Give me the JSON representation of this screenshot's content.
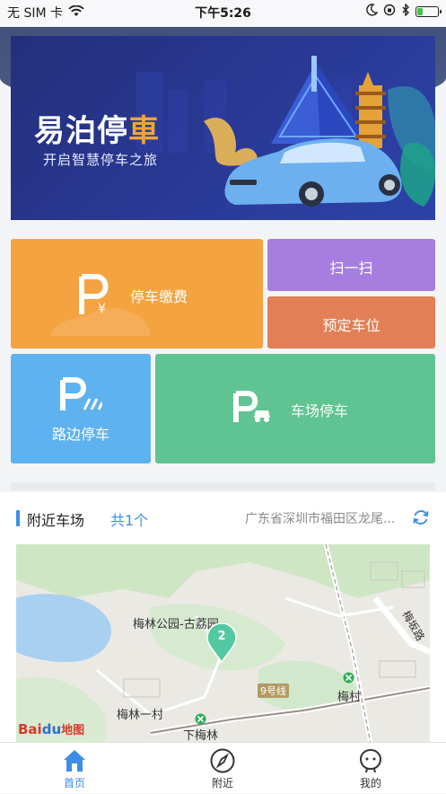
{
  "status_bar": {
    "carrier": "无 SIM 卡",
    "time": "下午5:26",
    "battery_level": 0.25,
    "battery_color": "#43c24a"
  },
  "banner": {
    "logo_text_a": "易泊停",
    "logo_text_b": "車",
    "slogan": "开启智慧停车之旅"
  },
  "services": {
    "pay_label": "停车缴费",
    "scan_label": "扫一扫",
    "reserve_label": "预定车位",
    "road_label": "路边停车",
    "lot_label": "车场停车",
    "colors": {
      "pay": "#f4a340",
      "scan": "#a77ee0",
      "reserve": "#e27f56",
      "road": "#5eb2ef",
      "lot": "#5fc491"
    }
  },
  "nearby": {
    "title": "附近车场",
    "count": "共1个",
    "address": "广东省深圳市福田区龙尾...",
    "accent": "#3d8de6",
    "map": {
      "labels": {
        "park": "梅林公园-古荔园",
        "village": "梅林一村",
        "station_xiameilin": "下梅林",
        "station_meicun": "梅村",
        "line": "9号线",
        "road": "梅坂路"
      },
      "marker_count": "2",
      "baidu_logo_a": "Bai",
      "baidu_logo_b": "du",
      "baidu_logo_c": "地图"
    }
  },
  "tabbar": {
    "items": [
      {
        "label": "首页",
        "icon": "home-icon",
        "active": true
      },
      {
        "label": "附近",
        "icon": "compass-icon",
        "active": false
      },
      {
        "label": "我的",
        "icon": "profile-icon",
        "active": false
      }
    ]
  }
}
